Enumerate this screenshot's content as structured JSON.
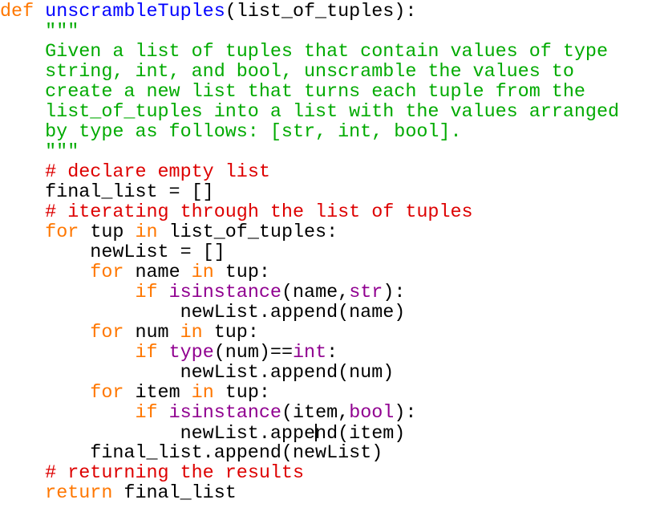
{
  "editor": {
    "language": "python",
    "colors": {
      "keyword": "#ff7700",
      "definition": "#0000ff",
      "builtin": "#900090",
      "comment": "#dd0000",
      "string": "#00aa00",
      "default": "#000000"
    },
    "cursor": {
      "line": 22,
      "after_text": "        newList.appe"
    },
    "lines": [
      [
        {
          "t": "kw",
          "v": "def"
        },
        {
          "t": "df",
          "v": " "
        },
        {
          "t": "fn",
          "v": "unscrambleTuples"
        },
        {
          "t": "df",
          "v": "(list_of_tuples):"
        }
      ],
      [
        {
          "t": "df",
          "v": "    "
        },
        {
          "t": "st",
          "v": "\"\"\""
        }
      ],
      [
        {
          "t": "st",
          "v": "    Given a list of tuples that contain values of type"
        }
      ],
      [
        {
          "t": "st",
          "v": "    string, int, and bool, unscramble the values to"
        }
      ],
      [
        {
          "t": "st",
          "v": "    create a new list that turns each tuple from the"
        }
      ],
      [
        {
          "t": "st",
          "v": "    list_of_tuples into a list with the values arranged"
        }
      ],
      [
        {
          "t": "st",
          "v": "    by type as follows: [str, int, bool]."
        }
      ],
      [
        {
          "t": "st",
          "v": "    \"\"\""
        }
      ],
      [
        {
          "t": "df",
          "v": "    "
        },
        {
          "t": "cm",
          "v": "# declare empty list"
        }
      ],
      [
        {
          "t": "df",
          "v": "    final_list = []"
        }
      ],
      [
        {
          "t": "df",
          "v": "    "
        },
        {
          "t": "cm",
          "v": "# iterating through the list of tuples"
        }
      ],
      [
        {
          "t": "df",
          "v": "    "
        },
        {
          "t": "kw",
          "v": "for"
        },
        {
          "t": "df",
          "v": " tup "
        },
        {
          "t": "kw",
          "v": "in"
        },
        {
          "t": "df",
          "v": " list_of_tuples:"
        }
      ],
      [
        {
          "t": "df",
          "v": "        newList = []"
        }
      ],
      [
        {
          "t": "df",
          "v": "        "
        },
        {
          "t": "kw",
          "v": "for"
        },
        {
          "t": "df",
          "v": " name "
        },
        {
          "t": "kw",
          "v": "in"
        },
        {
          "t": "df",
          "v": " tup:"
        }
      ],
      [
        {
          "t": "df",
          "v": "            "
        },
        {
          "t": "kw",
          "v": "if"
        },
        {
          "t": "df",
          "v": " "
        },
        {
          "t": "bi",
          "v": "isinstance"
        },
        {
          "t": "df",
          "v": "(name,"
        },
        {
          "t": "bi",
          "v": "str"
        },
        {
          "t": "df",
          "v": "):"
        }
      ],
      [
        {
          "t": "df",
          "v": "                newList.append(name)"
        }
      ],
      [
        {
          "t": "df",
          "v": "        "
        },
        {
          "t": "kw",
          "v": "for"
        },
        {
          "t": "df",
          "v": " num "
        },
        {
          "t": "kw",
          "v": "in"
        },
        {
          "t": "df",
          "v": " tup:"
        }
      ],
      [
        {
          "t": "df",
          "v": "            "
        },
        {
          "t": "kw",
          "v": "if"
        },
        {
          "t": "df",
          "v": " "
        },
        {
          "t": "bi",
          "v": "type"
        },
        {
          "t": "df",
          "v": "(num)=="
        },
        {
          "t": "bi",
          "v": "int"
        },
        {
          "t": "df",
          "v": ":"
        }
      ],
      [
        {
          "t": "df",
          "v": "                newList.append(num)"
        }
      ],
      [
        {
          "t": "df",
          "v": "        "
        },
        {
          "t": "kw",
          "v": "for"
        },
        {
          "t": "df",
          "v": " item "
        },
        {
          "t": "kw",
          "v": "in"
        },
        {
          "t": "df",
          "v": " tup:"
        }
      ],
      [
        {
          "t": "df",
          "v": "            "
        },
        {
          "t": "kw",
          "v": "if"
        },
        {
          "t": "df",
          "v": " "
        },
        {
          "t": "bi",
          "v": "isinstance"
        },
        {
          "t": "df",
          "v": "(item,"
        },
        {
          "t": "bi",
          "v": "bool"
        },
        {
          "t": "df",
          "v": "):"
        }
      ],
      [
        {
          "t": "df",
          "v": "                newList.appe"
        },
        {
          "t": "cursor",
          "v": ""
        },
        {
          "t": "df",
          "v": "nd(item)"
        }
      ],
      [
        {
          "t": "df",
          "v": "        final_list.append(newList)"
        }
      ],
      [
        {
          "t": "df",
          "v": "    "
        },
        {
          "t": "cm",
          "v": "# returning the results"
        }
      ],
      [
        {
          "t": "df",
          "v": "    "
        },
        {
          "t": "kw",
          "v": "return"
        },
        {
          "t": "df",
          "v": " final_list"
        }
      ]
    ]
  }
}
